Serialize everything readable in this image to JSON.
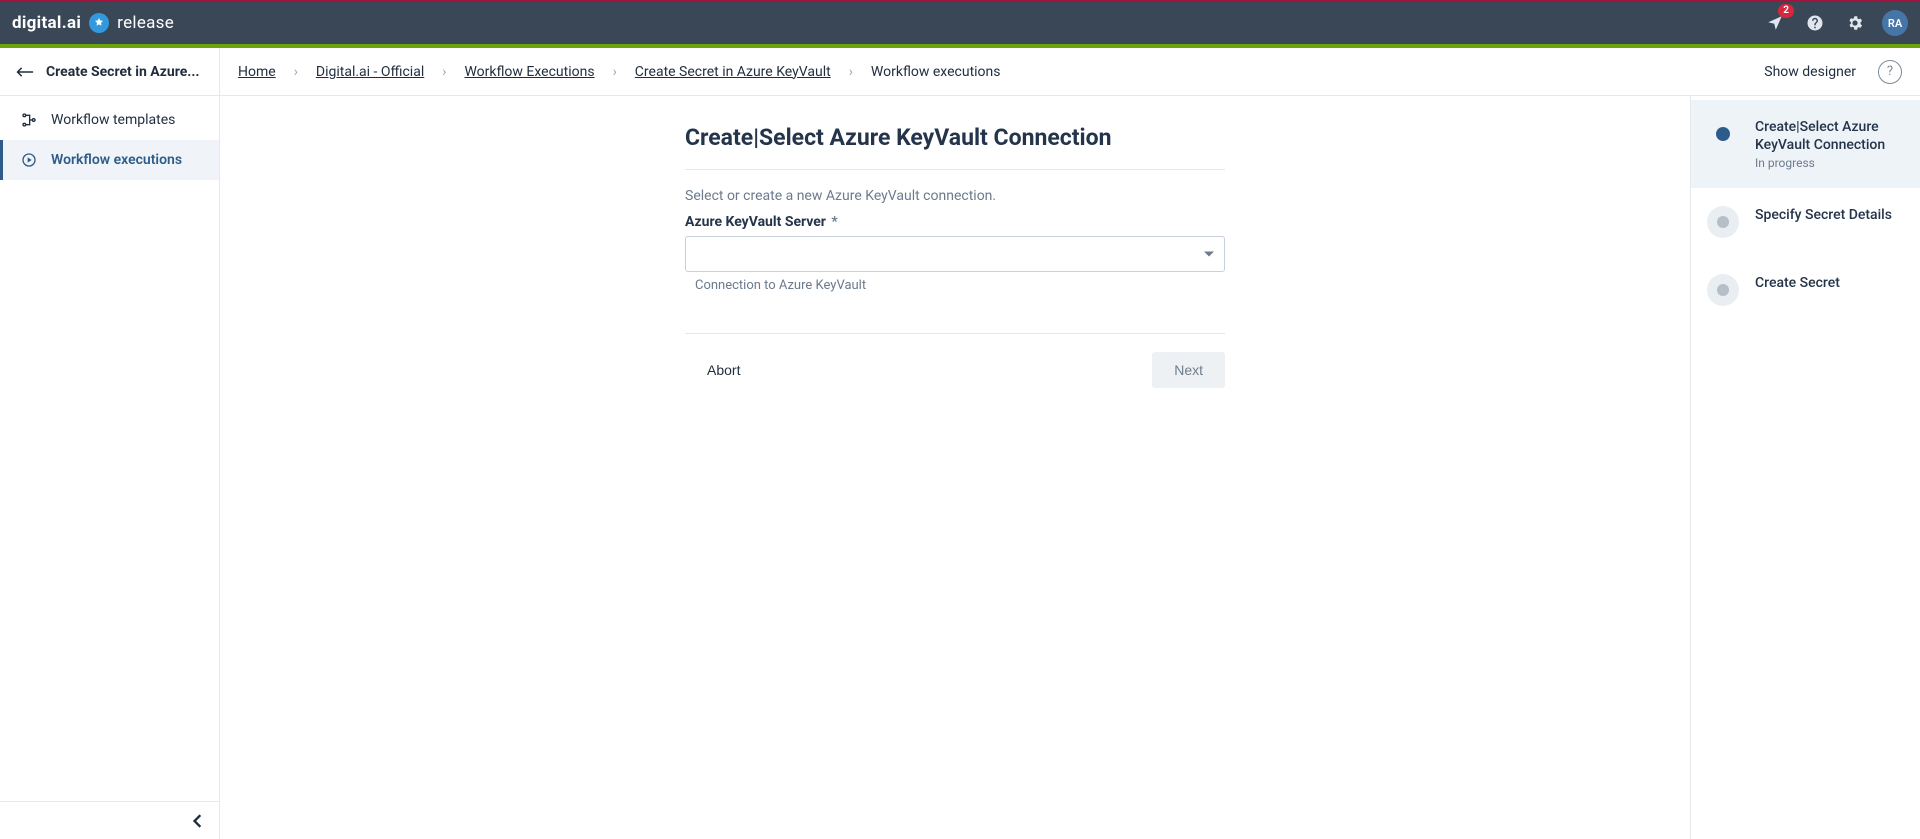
{
  "brand": {
    "logo": "digital.ai",
    "product": "release"
  },
  "topbar": {
    "notification_count": "2",
    "avatar_initials": "RA"
  },
  "sidebar": {
    "back_title": "Create Secret in Azure...",
    "items": [
      {
        "label": "Workflow templates",
        "active": false
      },
      {
        "label": "Workflow executions",
        "active": true
      }
    ]
  },
  "breadcrumbs": {
    "items": [
      {
        "label": "Home",
        "link": true
      },
      {
        "label": "Digital.ai - Official",
        "link": true
      },
      {
        "label": "Workflow Executions",
        "link": true
      },
      {
        "label": "Create Secret in Azure KeyVault",
        "link": true
      },
      {
        "label": "Workflow executions",
        "link": false
      }
    ],
    "right": {
      "show_designer": "Show designer"
    }
  },
  "form": {
    "title": "Create|Select Azure KeyVault Connection",
    "description": "Select or create a new Azure KeyVault connection.",
    "field_label": "Azure KeyVault Server",
    "field_hint": "Connection to Azure KeyVault",
    "select_value": "",
    "abort": "Abort",
    "next": "Next"
  },
  "steps": [
    {
      "title": "Create|Select Azure KeyVault Connection",
      "sub": "In progress",
      "active": true
    },
    {
      "title": "Specify Secret Details",
      "sub": "",
      "active": false
    },
    {
      "title": "Create Secret",
      "sub": "",
      "active": false
    }
  ]
}
